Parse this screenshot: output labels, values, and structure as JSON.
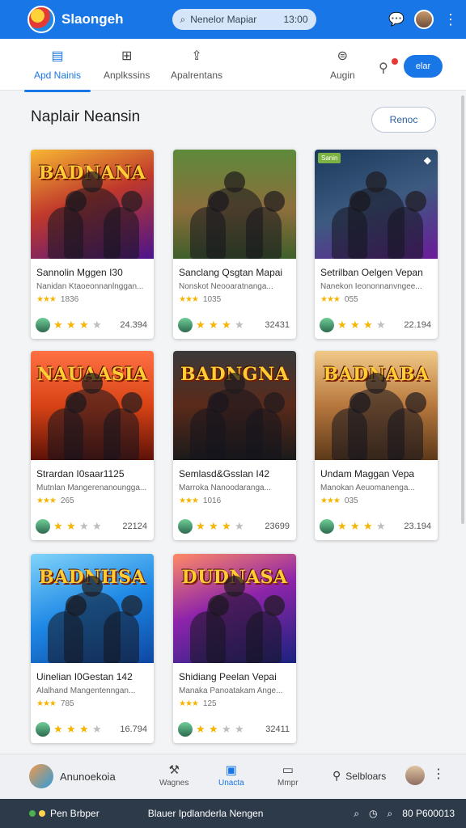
{
  "app": {
    "title": "Slaongeh",
    "search_placeholder": "Nenelor Mapiar",
    "search_time": "13:00"
  },
  "tabs": [
    {
      "label": "Apd Nainis",
      "icon": "grid-icon",
      "active": true
    },
    {
      "label": "Anplkssins",
      "icon": "apps-icon",
      "active": false
    },
    {
      "label": "Apalrentans",
      "icon": "share-icon",
      "active": false
    },
    {
      "label": "Augin",
      "icon": "dollar-icon",
      "active": false
    }
  ],
  "action_button": "elar",
  "section": {
    "title": "Naplair Neansin",
    "reset_label": "Renoc"
  },
  "cards": [
    {
      "art_title": "BADNANA",
      "title": "Sannolin Mggen I30",
      "subtitle": "Nanidan Ktaoeonnanlnggan...",
      "meta": "1836",
      "rating": 3,
      "count": "24.394",
      "theme": "a"
    },
    {
      "art_title": "",
      "title": "Sanclang Qsgtan Mapai",
      "subtitle": "Nonskot Neooaratnanga...",
      "meta": "1035",
      "rating": 3,
      "count": "32431",
      "theme": "b"
    },
    {
      "art_title": "",
      "title": "Setrilban Oelgen Vepan",
      "subtitle": "Nanekon Ieononnanvngee...",
      "meta": "055",
      "rating": 3,
      "count": "22.194",
      "theme": "c",
      "tag": "Sanin"
    },
    {
      "art_title": "NAUAASIA",
      "title": "Strardan I0saar1125",
      "subtitle": "Mutnlan Mangerenanoungga...",
      "meta": "265",
      "rating": 1.5,
      "count": "22124",
      "theme": "d"
    },
    {
      "art_title": "BADNGNA",
      "title": "Semlasd&Gsslan I42",
      "subtitle": "Marroka Nanoodaranga...",
      "meta": "1016",
      "rating": 3,
      "count": "23699",
      "theme": "e"
    },
    {
      "art_title": "BADNABA",
      "title": "Undam Maggan Vepa",
      "subtitle": "Manokan Aeuomanenga...",
      "meta": "035",
      "rating": 3,
      "count": "23.194",
      "theme": "f"
    },
    {
      "art_title": "BADNHSA",
      "title": "Uinelian I0Gestan 142",
      "subtitle": "Alalhand Mangentenngan...",
      "meta": "785",
      "rating": 3,
      "count": "16.794",
      "theme": "g"
    },
    {
      "art_title": "DUDNASA",
      "title": "Shidiang Peelan Vepai",
      "subtitle": "Manaka Panoatakam Ange...",
      "meta": "125",
      "rating": 1.5,
      "count": "32411",
      "theme": "h"
    }
  ],
  "bottom_nav": {
    "user_label": "Anunoekoia",
    "items": [
      {
        "label": "Wagnes",
        "icon": "puzzle-icon",
        "active": false
      },
      {
        "label": "Unacta",
        "icon": "calendar-icon",
        "active": true
      },
      {
        "label": "Mmpr",
        "icon": "window-icon",
        "active": false
      }
    ],
    "settings_label": "Selbloars"
  },
  "status_bar": {
    "left": "Pen Brbper",
    "center": "Blauer Ipdlanderla Nengen",
    "right": "80 P600013"
  }
}
